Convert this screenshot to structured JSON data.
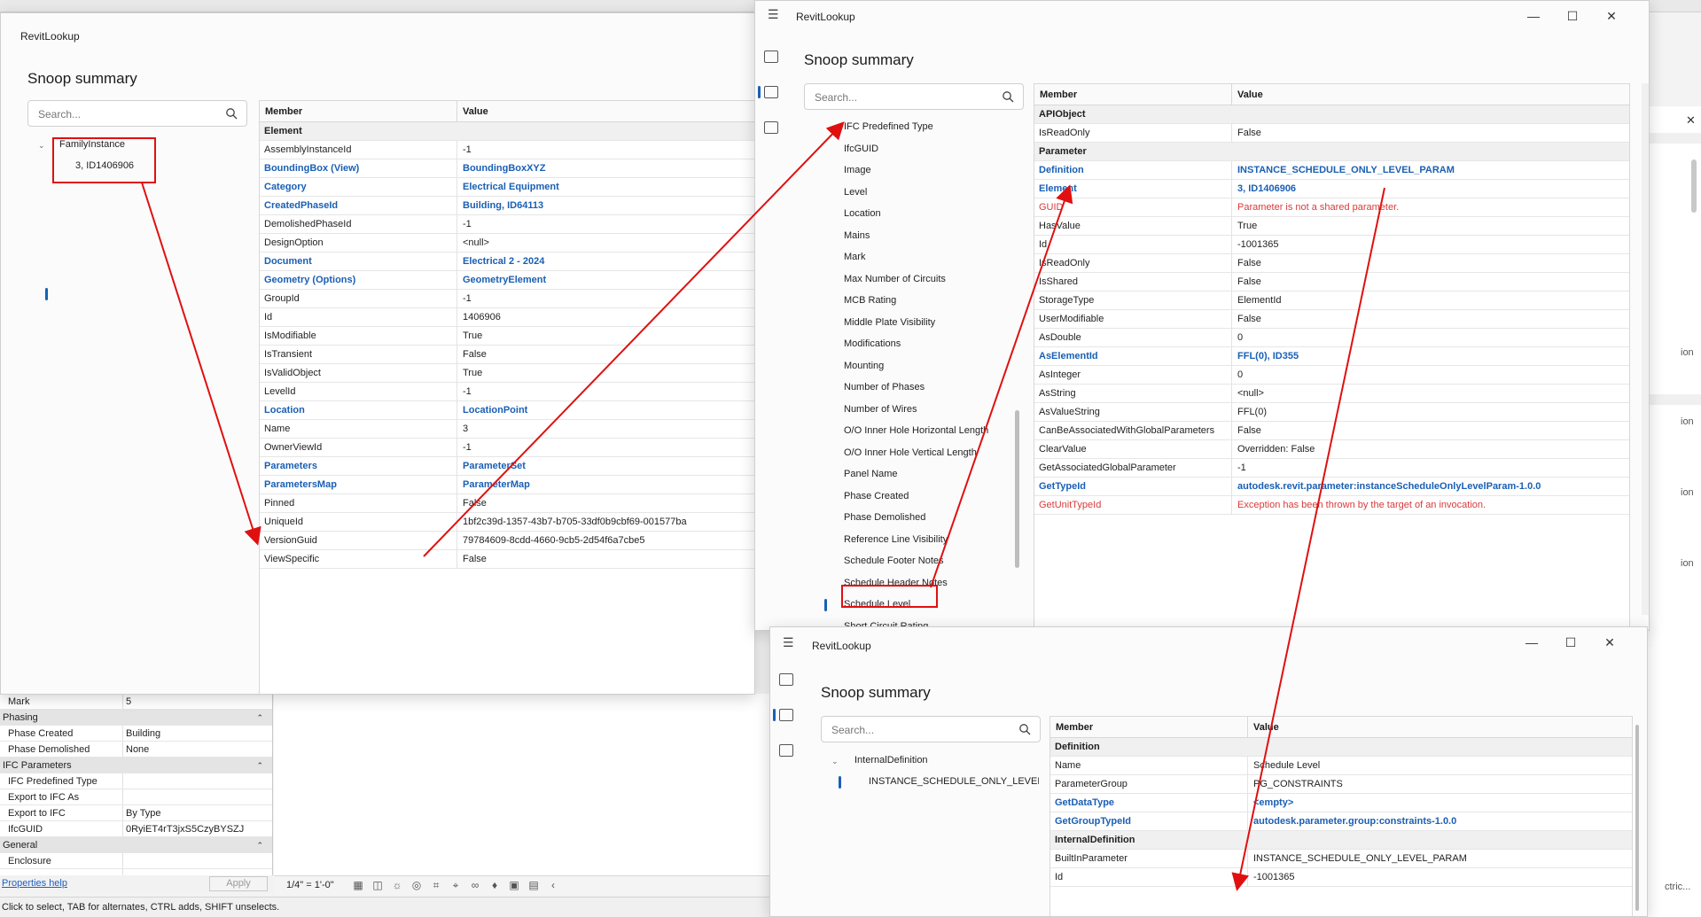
{
  "background": {
    "right_fragments": [
      "ion",
      "ion",
      "ion",
      "ion",
      "ctric..."
    ],
    "properties": {
      "rows": [
        {
          "type": "row",
          "label": "Mark",
          "value": "5"
        },
        {
          "type": "group",
          "label": "Phasing"
        },
        {
          "type": "row",
          "label": "Phase Created",
          "value": "Building"
        },
        {
          "type": "row",
          "label": "Phase Demolished",
          "value": "None"
        },
        {
          "type": "group",
          "label": "IFC Parameters"
        },
        {
          "type": "row",
          "label": "IFC Predefined Type",
          "value": ""
        },
        {
          "type": "row",
          "label": "Export to IFC As",
          "value": ""
        },
        {
          "type": "row",
          "label": "Export to IFC",
          "value": "By Type"
        },
        {
          "type": "row",
          "label": "IfcGUID",
          "value": "0RyiET4rT3jxS5CzyBYSZJ"
        },
        {
          "type": "group",
          "label": "General"
        },
        {
          "type": "row",
          "label": "Enclosure",
          "value": ""
        }
      ],
      "help_link": "Properties help",
      "apply_label": "Apply"
    },
    "view_scale": "1/4\" = 1'-0\"",
    "status_text": "Click to select, TAB for alternates, CTRL adds, SHIFT unselects."
  },
  "window1": {
    "title": "RevitLookup",
    "heading": "Snoop summary",
    "search_placeholder": "Search...",
    "tree": {
      "parent": "FamilyInstance",
      "child": "3, ID1406906"
    },
    "columns": {
      "member": "Member",
      "value": "Value"
    },
    "rows": [
      {
        "kind": "group",
        "member": "Element",
        "value": ""
      },
      {
        "kind": "plain",
        "member": "AssemblyInstanceId",
        "value": "-1"
      },
      {
        "kind": "link",
        "member": "BoundingBox (View)",
        "value": "BoundingBoxXYZ"
      },
      {
        "kind": "link",
        "member": "Category",
        "value": "Electrical Equipment"
      },
      {
        "kind": "link",
        "member": "CreatedPhaseId",
        "value": "Building, ID64113"
      },
      {
        "kind": "plain",
        "member": "DemolishedPhaseId",
        "value": "-1"
      },
      {
        "kind": "plain",
        "member": "DesignOption",
        "value": "<null>"
      },
      {
        "kind": "link",
        "member": "Document",
        "value": "Electrical 2 - 2024"
      },
      {
        "kind": "link",
        "member": "Geometry (Options)",
        "value": "GeometryElement"
      },
      {
        "kind": "plain",
        "member": "GroupId",
        "value": "-1"
      },
      {
        "kind": "plain",
        "member": "Id",
        "value": "1406906"
      },
      {
        "kind": "plain",
        "member": "IsModifiable",
        "value": "True"
      },
      {
        "kind": "plain",
        "member": "IsTransient",
        "value": "False"
      },
      {
        "kind": "plain",
        "member": "IsValidObject",
        "value": "True"
      },
      {
        "kind": "plain",
        "member": "LevelId",
        "value": "-1"
      },
      {
        "kind": "link",
        "member": "Location",
        "value": "LocationPoint"
      },
      {
        "kind": "plain",
        "member": "Name",
        "value": "3"
      },
      {
        "kind": "plain",
        "member": "OwnerViewId",
        "value": "-1"
      },
      {
        "kind": "link",
        "member": "Parameters",
        "value": "ParameterSet"
      },
      {
        "kind": "link",
        "member": "ParametersMap",
        "value": "ParameterMap"
      },
      {
        "kind": "plain",
        "member": "Pinned",
        "value": "False"
      },
      {
        "kind": "plain",
        "member": "UniqueId",
        "value": "1bf2c39d-1357-43b7-b705-33df0b9cbf69-001577ba"
      },
      {
        "kind": "plain",
        "member": "VersionGuid",
        "value": "79784609-8cdd-4660-9cb5-2d54f6a7cbe5"
      },
      {
        "kind": "plain",
        "member": "ViewSpecific",
        "value": "False"
      }
    ]
  },
  "window2": {
    "title": "RevitLookup",
    "heading": "Snoop summary",
    "search_placeholder": "Search...",
    "caption": {
      "minimize": "—",
      "maximize": "☐",
      "close": "✕"
    },
    "tree_items": [
      "IFC Predefined Type",
      "IfcGUID",
      "Image",
      "Level",
      "Location",
      "Mains",
      "Mark",
      "Max Number of Circuits",
      "MCB Rating",
      "Middle Plate Visibility",
      "Modifications",
      "Mounting",
      "Number of Phases",
      "Number of Wires",
      "O/O Inner Hole Horizontal Length",
      "O/O Inner Hole Vertical Length",
      "Panel Name",
      "Phase Created",
      "Phase Demolished",
      "Reference Line Visibility",
      "Schedule Footer Notes",
      "Schedule Header Notes",
      "Schedule Level",
      "Short Circuit Rating"
    ],
    "columns": {
      "member": "Member",
      "value": "Value"
    },
    "rows": [
      {
        "kind": "group",
        "member": "APIObject",
        "value": ""
      },
      {
        "kind": "plain",
        "member": "IsReadOnly",
        "value": "False"
      },
      {
        "kind": "group",
        "member": "Parameter",
        "value": ""
      },
      {
        "kind": "link",
        "member": "Definition",
        "value": "INSTANCE_SCHEDULE_ONLY_LEVEL_PARAM"
      },
      {
        "kind": "link",
        "member": "Element",
        "value": "3, ID1406906"
      },
      {
        "kind": "err",
        "member": "GUID",
        "value": "Parameter is not a shared parameter."
      },
      {
        "kind": "plain",
        "member": "HasValue",
        "value": "True"
      },
      {
        "kind": "plain",
        "member": "Id",
        "value": "-1001365"
      },
      {
        "kind": "plain",
        "member": "IsReadOnly",
        "value": "False"
      },
      {
        "kind": "plain",
        "member": "IsShared",
        "value": "False"
      },
      {
        "kind": "plain",
        "member": "StorageType",
        "value": "ElementId"
      },
      {
        "kind": "plain",
        "member": "UserModifiable",
        "value": "False"
      },
      {
        "kind": "plain",
        "member": "AsDouble",
        "value": "0"
      },
      {
        "kind": "link",
        "member": "AsElementId",
        "value": "FFL(0), ID355"
      },
      {
        "kind": "plain",
        "member": "AsInteger",
        "value": "0"
      },
      {
        "kind": "plain",
        "member": "AsString",
        "value": "<null>"
      },
      {
        "kind": "plain",
        "member": "AsValueString",
        "value": "FFL(0)"
      },
      {
        "kind": "plain",
        "member": "CanBeAssociatedWithGlobalParameters",
        "value": "False"
      },
      {
        "kind": "plain",
        "member": "ClearValue",
        "value": "Overridden: False"
      },
      {
        "kind": "plain",
        "member": "GetAssociatedGlobalParameter",
        "value": "-1"
      },
      {
        "kind": "link",
        "member": "GetTypeId",
        "value": "autodesk.revit.parameter:instanceScheduleOnlyLevelParam-1.0.0"
      },
      {
        "kind": "err",
        "member": "GetUnitTypeId",
        "value": "Exception has been thrown by the target of an invocation."
      }
    ]
  },
  "window3": {
    "title": "RevitLookup",
    "heading": "Snoop summary",
    "search_placeholder": "Search...",
    "caption": {
      "minimize": "—",
      "maximize": "☐",
      "close": "✕"
    },
    "tree": {
      "parent": "InternalDefinition",
      "child": "INSTANCE_SCHEDULE_ONLY_LEVEL_I"
    },
    "columns": {
      "member": "Member",
      "value": "Value"
    },
    "rows": [
      {
        "kind": "group",
        "member": "Definition",
        "value": ""
      },
      {
        "kind": "plain",
        "member": "Name",
        "value": "Schedule Level"
      },
      {
        "kind": "plain",
        "member": "ParameterGroup",
        "value": "PG_CONSTRAINTS"
      },
      {
        "kind": "link",
        "member": "GetDataType",
        "value": "<empty>"
      },
      {
        "kind": "link",
        "member": "GetGroupTypeId",
        "value": "autodesk.parameter.group:constraints-1.0.0"
      },
      {
        "kind": "group",
        "member": "InternalDefinition",
        "value": ""
      },
      {
        "kind": "plain",
        "member": "BuiltInParameter",
        "value": "INSTANCE_SCHEDULE_ONLY_LEVEL_PARAM"
      },
      {
        "kind": "plain",
        "member": "Id",
        "value": "-1001365"
      }
    ]
  },
  "colors": {
    "accent": "#1a5fb4",
    "error": "#d83b3b",
    "annotation": "#e01010"
  }
}
